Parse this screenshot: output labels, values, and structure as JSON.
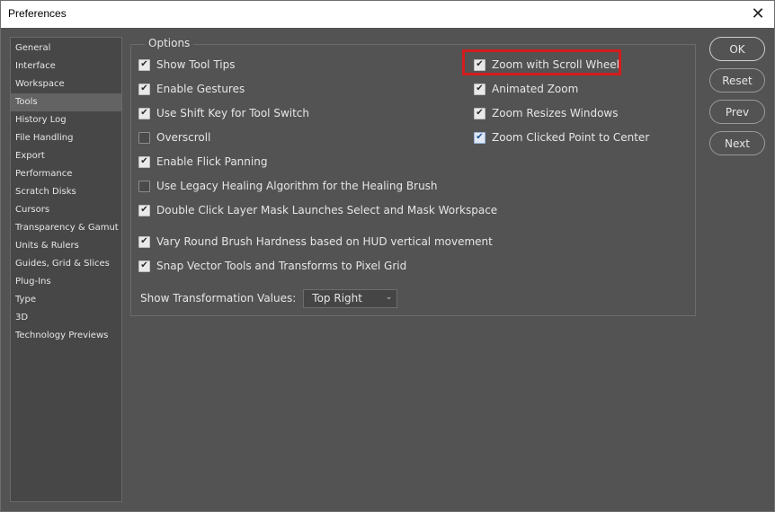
{
  "window": {
    "title": "Preferences",
    "close_glyph": "✕"
  },
  "sidebar": {
    "items": [
      {
        "label": "General"
      },
      {
        "label": "Interface"
      },
      {
        "label": "Workspace"
      },
      {
        "label": "Tools",
        "active": true
      },
      {
        "label": "History Log"
      },
      {
        "label": "File Handling"
      },
      {
        "label": "Export"
      },
      {
        "label": "Performance"
      },
      {
        "label": "Scratch Disks"
      },
      {
        "label": "Cursors"
      },
      {
        "label": "Transparency & Gamut"
      },
      {
        "label": "Units & Rulers"
      },
      {
        "label": "Guides, Grid & Slices"
      },
      {
        "label": "Plug-Ins"
      },
      {
        "label": "Type"
      },
      {
        "label": "3D"
      },
      {
        "label": "Technology Previews"
      }
    ]
  },
  "options": {
    "title": "Options",
    "left": [
      {
        "label": "Show Tool Tips",
        "checked": true
      },
      {
        "label": "Enable Gestures",
        "checked": true
      },
      {
        "label": "Use Shift Key for Tool Switch",
        "checked": true
      },
      {
        "label": "Overscroll",
        "checked": false
      },
      {
        "label": "Enable Flick Panning",
        "checked": true
      },
      {
        "label": "Use Legacy Healing Algorithm for the Healing Brush",
        "checked": false
      },
      {
        "label": "Double Click Layer Mask Launches Select and Mask Workspace",
        "checked": true
      },
      {
        "label": "Vary Round Brush Hardness based on HUD vertical movement",
        "checked": true
      },
      {
        "label": "Snap Vector Tools and Transforms to Pixel Grid",
        "checked": true
      }
    ],
    "right": [
      {
        "label": "Zoom with Scroll Wheel",
        "checked": true
      },
      {
        "label": "Animated Zoom",
        "checked": true
      },
      {
        "label": "Zoom Resizes Windows",
        "checked": true
      },
      {
        "label": "Zoom Clicked Point to Center",
        "checked": true
      }
    ],
    "transformation": {
      "label": "Show Transformation Values:",
      "value": "Top Right"
    }
  },
  "buttons": {
    "ok": "OK",
    "reset": "Reset",
    "prev": "Prev",
    "next": "Next"
  },
  "colors": {
    "highlight": "#d41d1d",
    "panel": "#535353"
  }
}
